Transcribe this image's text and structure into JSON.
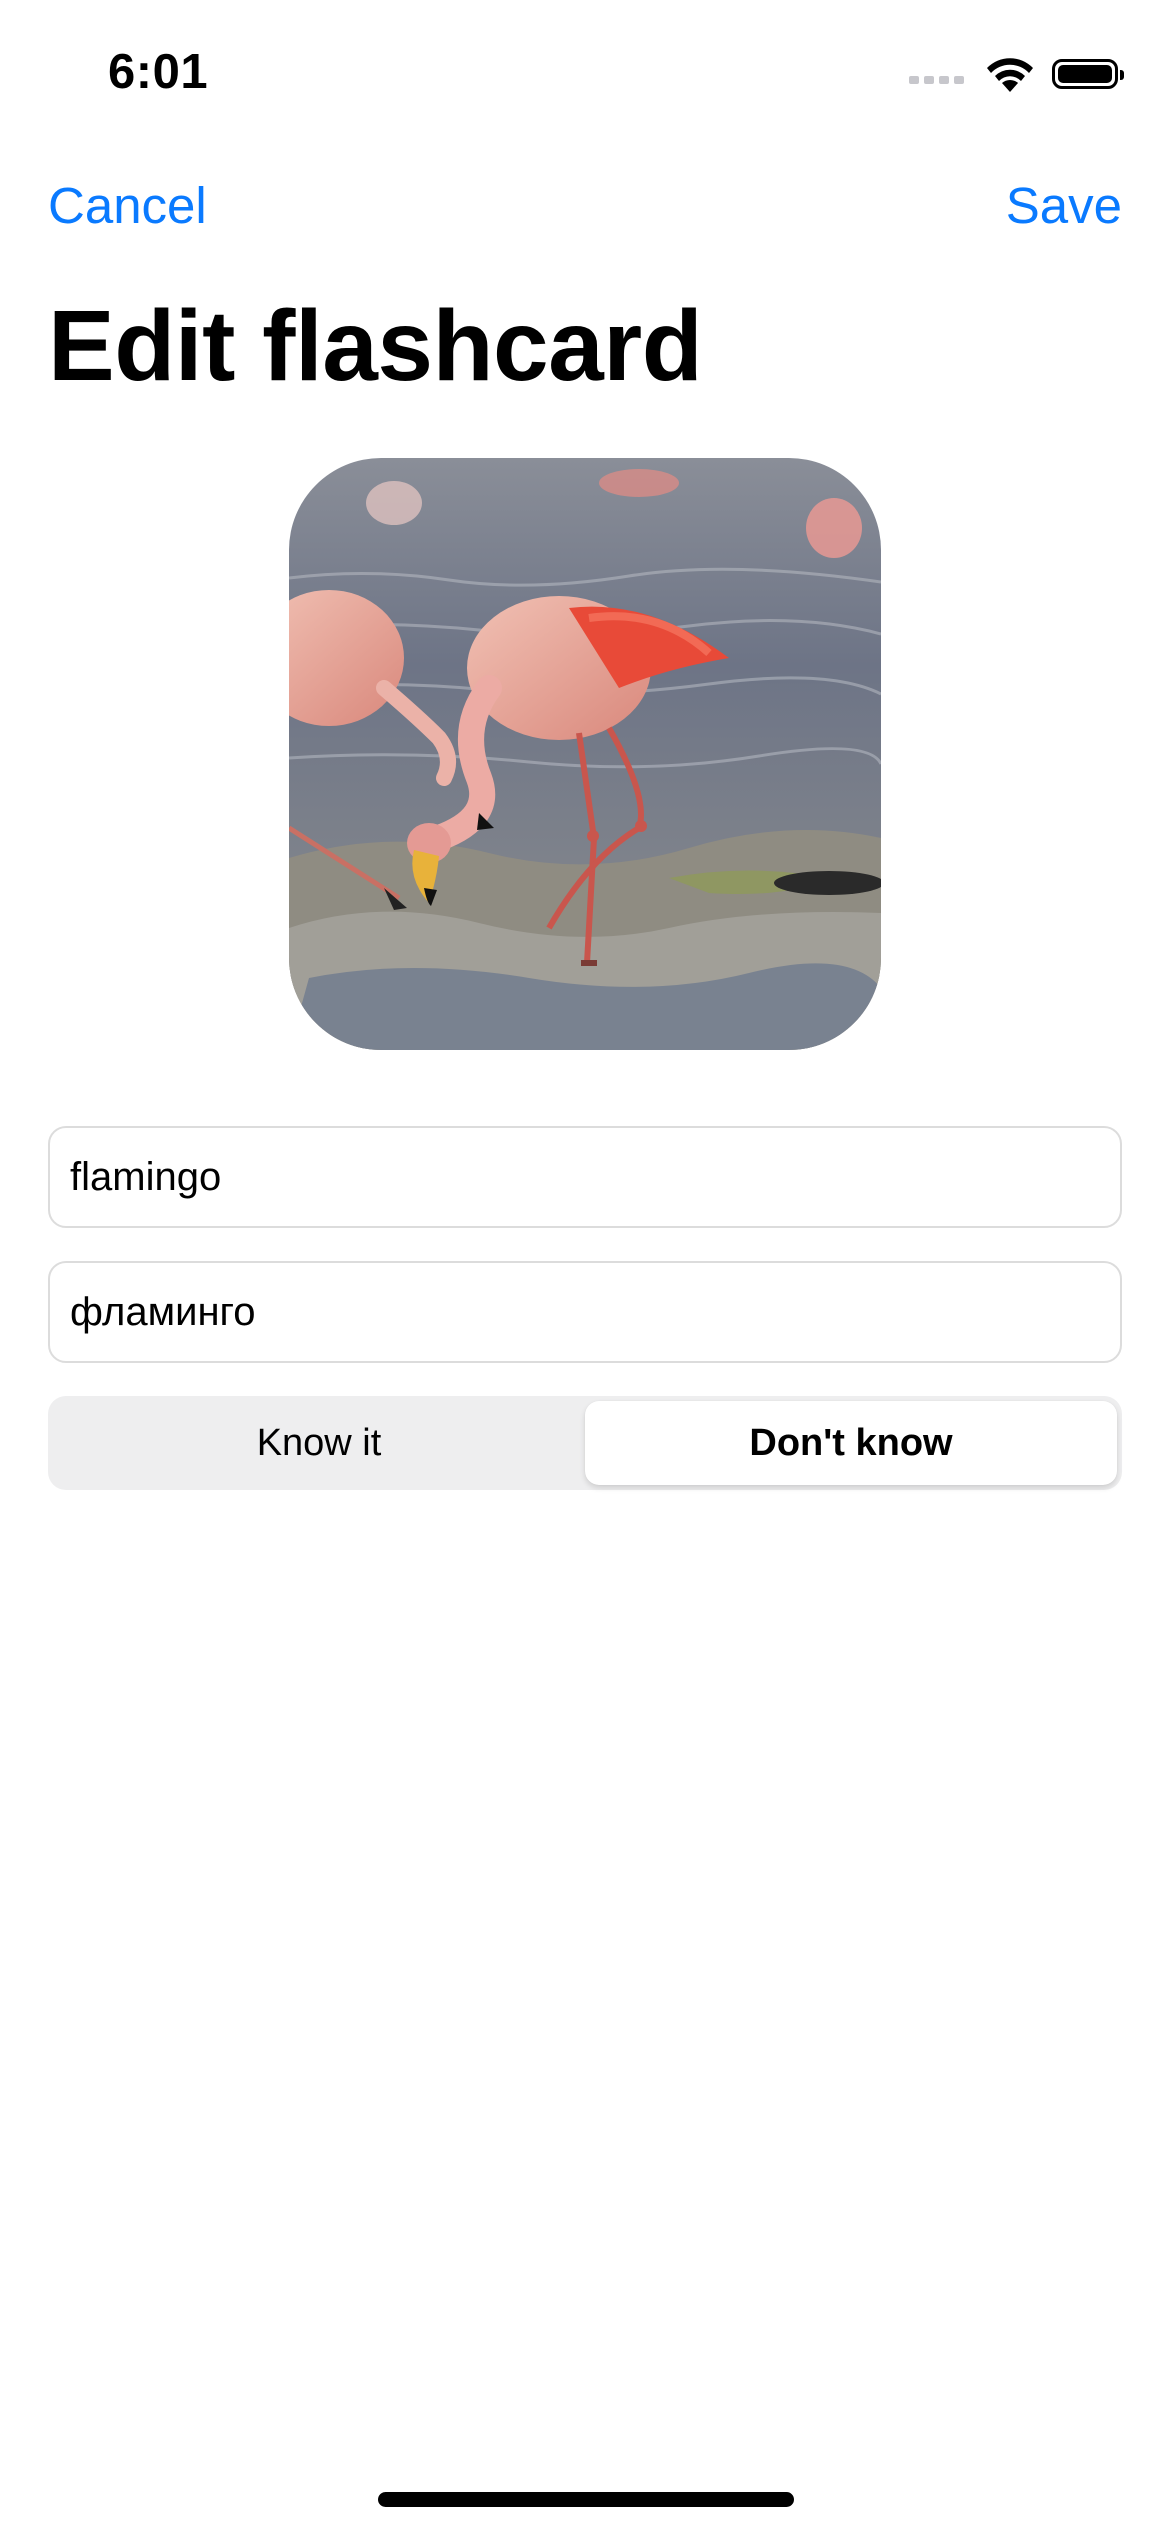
{
  "status_bar": {
    "time": "6:01",
    "icons": [
      "cellular-signal-icon",
      "wifi-icon",
      "battery-icon"
    ]
  },
  "nav": {
    "cancel_label": "Cancel",
    "save_label": "Save",
    "accent_color": "#0a7aff"
  },
  "title": "Edit flashcard",
  "form": {
    "term_value": "flamingo",
    "translation_value": "фламинго"
  },
  "knowledge": {
    "options": [
      "Know it",
      "Don't know"
    ],
    "selected": "Don't know"
  }
}
